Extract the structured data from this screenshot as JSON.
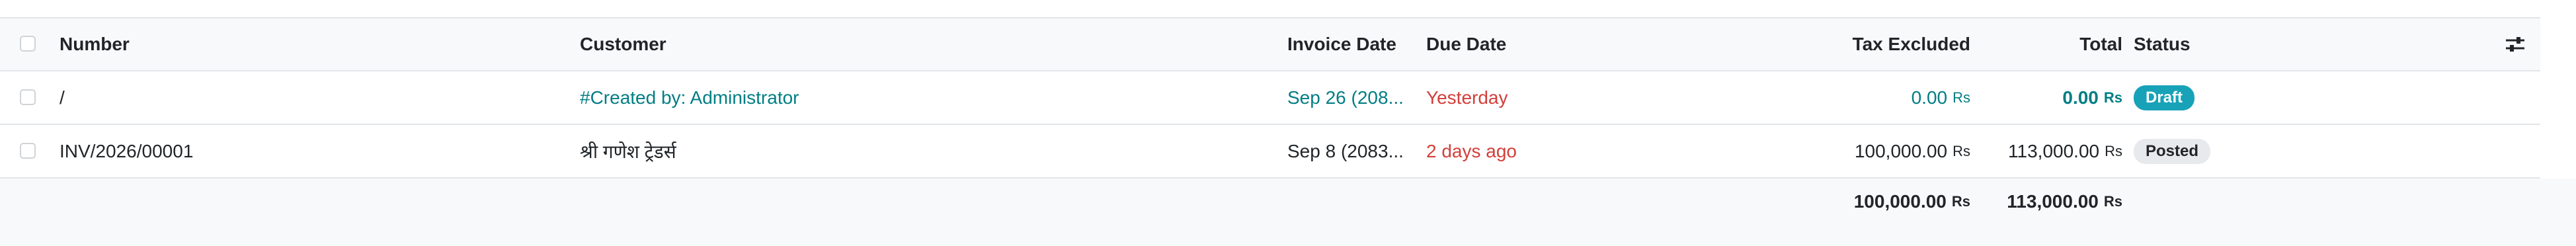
{
  "columns": {
    "number": "Number",
    "customer": "Customer",
    "invoice_date": "Invoice Date",
    "due_date": "Due Date",
    "tax_excluded": "Tax Excluded",
    "total": "Total",
    "status": "Status"
  },
  "rows": [
    {
      "number": "/",
      "customer": "#Created by: Administrator",
      "invoice_date": "Sep 26 (208...",
      "due_date": "Yesterday",
      "tax_excluded": "0.00",
      "total": "0.00",
      "currency": "Rs",
      "status": "Draft"
    },
    {
      "number": "INV/2026/00001",
      "customer": "श्री गणेश ट्रेडर्स",
      "invoice_date": "Sep 8 (2083...",
      "due_date": "2 days ago",
      "tax_excluded": "100,000.00",
      "total": "113,000.00",
      "currency": "Rs",
      "status": "Posted"
    }
  ],
  "totals": {
    "tax_excluded": "100,000.00",
    "total": "113,000.00",
    "currency": "Rs"
  },
  "colors": {
    "link": "#017e84",
    "danger": "#d23f3a",
    "draft_badge": "#17a2b8",
    "posted_badge": "#e7e9ed"
  },
  "icons": {
    "column_settings": "sliders-icon"
  }
}
